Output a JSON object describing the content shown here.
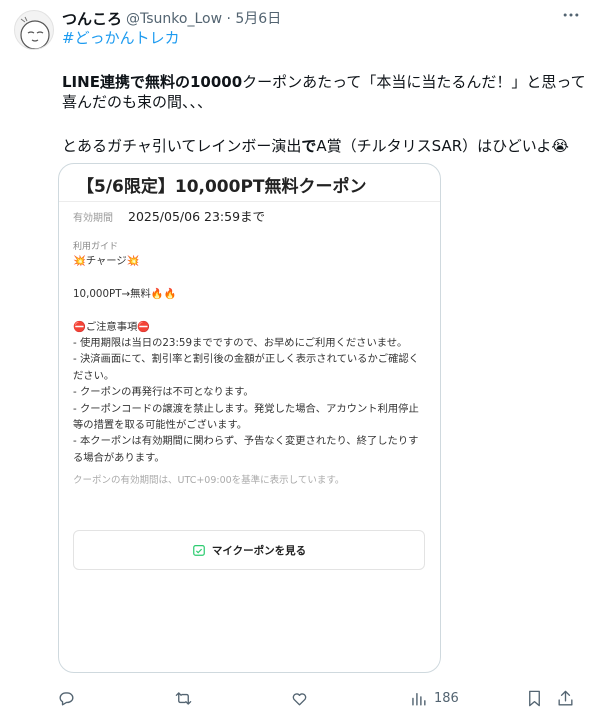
{
  "author": {
    "display_name": "つんころ",
    "handle_line": "@Tsunko_Low · 5月6日"
  },
  "hashtag": "#どっかんトレカ",
  "tweet": {
    "line1_bold1": "LINE連携で",
    "line1_bold2": "無料の10000",
    "line1_rest": "クーポンあたって「本当に当たるんだ！」と思って",
    "line2": "喜んだのも束の間、、、",
    "line3_pre": "とあるガチャ引いてレインボー演出",
    "line3_bold": "で",
    "line3_post": "A賞（チルタリスSAR）はひどいよ😭"
  },
  "coupon": {
    "title": "【5/6限定】10,000PT無料クーポン",
    "expiry_label": "有効期間",
    "expiry_value": "2025/05/06 23:59まで",
    "guide_label": "利用ガイド",
    "lines": [
      "💥チャージ💥",
      "",
      "10,000PT→無料🔥🔥",
      "",
      "⛔ご注意事項⛔",
      "- 使用期限は当日の23:59までですので、お早めにご利用くださいませ。",
      "- 決済画面にて、割引率と割引後の金額が正しく表示されているかご確認く",
      "ださい。",
      "- クーポンの再発行は不可となります。",
      "- クーポンコードの譲渡を禁止します。発覚した場合、アカウント利用停止",
      "等の措置を取る可能性がございます。",
      "- 本クーポンは有効期間に関わらず、予告なく変更されたり、終了したりす",
      "る場合があります。"
    ],
    "timezone_note": "クーポンの有効期間は、UTC+09:00を基準に表示しています。",
    "button_label": "マイクーポンを見る"
  },
  "actions": {
    "views": "186"
  },
  "icons": [
    "more-icon",
    "reply-icon",
    "retweet-icon",
    "like-icon",
    "views-icon",
    "bookmark-icon",
    "share-icon",
    "coupon-icon"
  ]
}
